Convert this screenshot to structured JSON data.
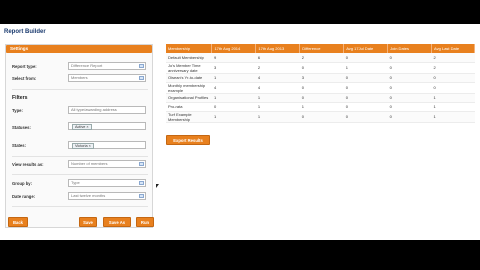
{
  "title": "Report Builder",
  "settings_header": "Settings",
  "report_type": {
    "label": "Report type:",
    "value": "Difference Report"
  },
  "select_from": {
    "label": "Select from:",
    "value": "Members"
  },
  "filters": {
    "heading": "Filters",
    "type": {
      "label": "Type:",
      "placeholder": "All type/awarding address"
    },
    "statuses": {
      "label": "Statuses:",
      "tags": [
        "Active"
      ]
    },
    "states": {
      "label": "States:",
      "tags": [
        "Victoria"
      ]
    }
  },
  "view_results": {
    "label": "View results as:",
    "value": "Number of members"
  },
  "group_by": {
    "label": "Group by:",
    "value": "Type"
  },
  "date_range": {
    "label": "Date range:",
    "value": "Last twelve months"
  },
  "buttons": {
    "back": "Back",
    "save": "Save",
    "save_as": "Save As",
    "run": "Run"
  },
  "table": {
    "headers": [
      "Membership",
      "17th Aug 2014",
      "17th Aug 2013",
      "Difference",
      "Avg 17Jul Date",
      "Join Dates",
      "Avg Last Date"
    ],
    "rows": [
      [
        "Default Membership",
        "9",
        "6",
        "2",
        "0",
        "0",
        "2"
      ],
      [
        "Jo's Member Time anniversary date",
        "3",
        "2",
        "0",
        "1",
        "0",
        "2"
      ],
      [
        "Oisean's Yr-to-date",
        "1",
        "4",
        "3",
        "0",
        "0",
        "0"
      ],
      [
        "Monthly membership example",
        "4",
        "4",
        "0",
        "0",
        "0",
        "0"
      ],
      [
        "Organisational Profiles",
        "1",
        "1",
        "0",
        "0",
        "0",
        "1"
      ],
      [
        "Pro-rata",
        "0",
        "1",
        "1",
        "0",
        "0",
        "1"
      ],
      [
        "Turf Example Membership",
        "1",
        "1",
        "0",
        "0",
        "0",
        "1"
      ]
    ]
  },
  "export_button": "Export Results"
}
